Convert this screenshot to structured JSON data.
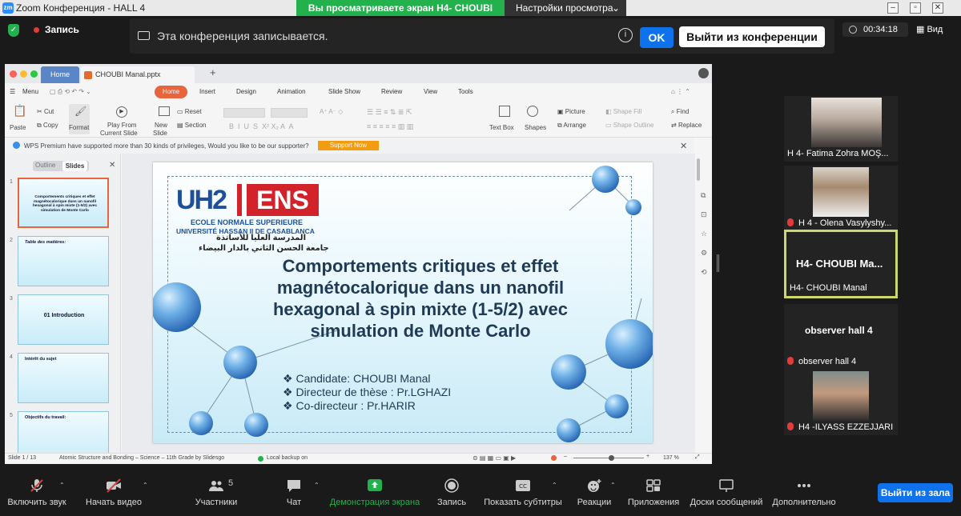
{
  "window": {
    "title": "Zoom Конференция - HALL 4",
    "sharing_banner": "Вы просматриваете экран H4- CHOUBI Manal",
    "view_settings": "Настройки просмотра"
  },
  "top": {
    "recording_label": "Запись",
    "notice_text": "Эта конференция записывается.",
    "ok_label": "OK",
    "leave_label": "Выйти из конференции",
    "timer": "00:34:18",
    "view_label": "Вид"
  },
  "wps": {
    "home_tab": "Home",
    "file_tab": "CHOUBI Manal.pptx",
    "menu": [
      "Menu",
      "Home",
      "Insert",
      "Design",
      "Animation",
      "Slide Show",
      "Review",
      "View",
      "Tools"
    ],
    "ribbon": {
      "paste": "Paste",
      "cut": "Cut",
      "copy": "Copy",
      "format": "Format",
      "play": "Play From",
      "current": "Current Slide",
      "newslide": "New",
      "slide": "Slide",
      "reset": "Reset",
      "section": "Section",
      "textbox": "Text Box",
      "shapes": "Shapes",
      "picture": "Picture",
      "arrange": "Arrange",
      "shapefill": "Shape Fill",
      "shapeoutline": "Shape Outline",
      "find": "Find",
      "replace": "Replace"
    },
    "premium_text": "WPS Premium have supported more than 30 kinds of privileges, Would you like to be our supporter?",
    "support_btn": "Support Now",
    "outline_label": "Outline",
    "slides_label": "Slides",
    "thumbs": [
      {
        "num": "1",
        "title": "Comportements critiques et effet magnétocalorique dans un nanofil hexagonal à spin mixte (1-5/2) avec simulation de Monte Carlo"
      },
      {
        "num": "2",
        "title": "Table des matières:"
      },
      {
        "num": "3",
        "title": "01 Introduction"
      },
      {
        "num": "4",
        "title": "Intérêt du sujet"
      },
      {
        "num": "5",
        "title": "Objectifs du travail:"
      }
    ],
    "status": {
      "slide": "Slide 1 / 13",
      "theme": "Atomic Structure and Bonding – Science – 11th Grade by Slidesgo",
      "backup": "Local backup on",
      "zoom": "137 %"
    }
  },
  "slide": {
    "logo_uh2": "UH2",
    "logo_ens": "ENS",
    "school_line1": "ECOLE NORMALE SUPERIEURE",
    "school_line2": "UNIVERSITÉ HASSAN II DE CASABLANCA",
    "arabic_line1": "المدرسة العليا للأساتذة",
    "arabic_line2": "جامعة الحسن الثاني بالدار البيضاء",
    "title": "Comportements critiques et effet magnétocalorique dans un nanofil hexagonal à spin mixte (1-5/2) avec simulation de Monte Carlo",
    "bullets": [
      "Candidate: CHOUBI Manal",
      "Directeur de thèse : Pr.LGHAZI",
      "Co-directeur : Pr.HARIR"
    ]
  },
  "participants": [
    {
      "name": "H 4- Fatima Zohra MOŞ...",
      "muted": false
    },
    {
      "name": "H 4 - Olena Vasylyshy...",
      "muted": true
    },
    {
      "name": "H4- CHOUBI Manal",
      "big": "H4- CHOUBI Ma...",
      "muted": false
    },
    {
      "name": "observer hall 4",
      "big": "observer hall 4",
      "muted": true
    },
    {
      "name": "H4 -ILYASS EZZEJJARI",
      "muted": true
    }
  ],
  "toolbar": {
    "unmute": "Включить звук",
    "video": "Начать видео",
    "participants": "Участники",
    "participants_count": "5",
    "chat": "Чат",
    "share": "Демонстрация экрана",
    "record": "Запись",
    "captions": "Показать субтитры",
    "reactions": "Реакции",
    "apps": "Приложения",
    "whiteboards": "Доски сообщений",
    "more": "Дополнительно",
    "leave": "Выйти из зала"
  },
  "colors": {
    "zoom_green": "#23b14d",
    "zoom_blue": "#0e72ed",
    "wps_orange": "#e8643c",
    "active_speaker": "#ccd86b"
  }
}
